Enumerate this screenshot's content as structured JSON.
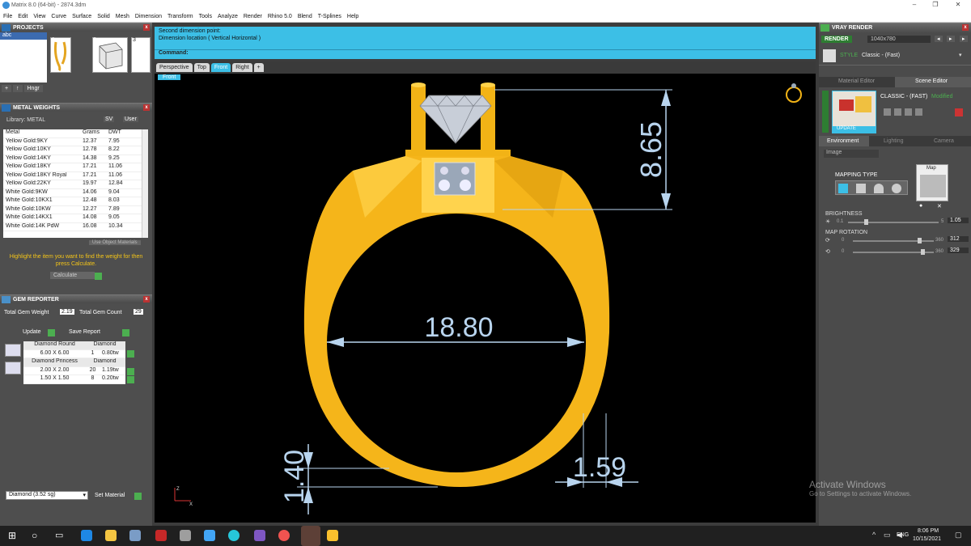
{
  "window": {
    "title": "Matrix 8.0 (64-bit) - 2874.3dm"
  },
  "menu": [
    "File",
    "Edit",
    "View",
    "Curve",
    "Surface",
    "Solid",
    "Mesh",
    "Dimension",
    "Transform",
    "Tools",
    "Analyze",
    "Render",
    "Rhino 5.0",
    "Blend",
    "T-Splines",
    "Help"
  ],
  "projects": {
    "header": "PROJECTS",
    "item": "abc",
    "thumb_labels": [
      "1",
      "2",
      "3"
    ],
    "buttons": [
      "+",
      "↑",
      "Hngr"
    ]
  },
  "metal_weights": {
    "header": "METAL WEIGHTS",
    "library_label": "Library: METAL",
    "sv_label": "SV",
    "user_label": "User",
    "columns": [
      "Metal",
      "Grams",
      "DWT"
    ],
    "rows": [
      [
        "Yellow Gold:9KY",
        "12.37",
        "7.95"
      ],
      [
        "Yellow Gold:10KY",
        "12.78",
        "8.22"
      ],
      [
        "Yellow Gold:14KY",
        "14.38",
        "9.25"
      ],
      [
        "Yellow Gold:18KY",
        "17.21",
        "11.06"
      ],
      [
        "Yellow Gold:18KY Royal",
        "17.21",
        "11.06"
      ],
      [
        "Yellow Gold:22KY",
        "19.97",
        "12.84"
      ],
      [
        "White Gold:9KW",
        "14.06",
        "9.04"
      ],
      [
        "White Gold:10KX1",
        "12.48",
        "8.03"
      ],
      [
        "White Gold:10KW",
        "12.27",
        "7.89"
      ],
      [
        "White Gold:14KX1",
        "14.08",
        "9.05"
      ],
      [
        "White Gold:14K PdW",
        "16.08",
        "10.34"
      ]
    ],
    "use_object_materials": "Use Object Materials",
    "hint": "Highlight the item you want to find the weight for then press Calculate.",
    "calculate": "Calculate"
  },
  "gem_reporter": {
    "header": "GEM REPORTER",
    "total_weight_label": "Total Gem Weight",
    "total_weight": "2.19",
    "total_count_label": "Total Gem Count",
    "total_count": "29",
    "update": "Update",
    "save_report": "Save Report",
    "groups": [
      {
        "shape": "Diamond Round",
        "material": "Diamond",
        "rows": [
          [
            "6.00 X 6.00",
            "1",
            "0.80tw"
          ]
        ]
      },
      {
        "shape": "Diamond Princess",
        "material": "Diamond",
        "rows": [
          [
            "2.00 X 2.00",
            "20",
            "1.19tw"
          ],
          [
            "1.50 X 1.50",
            "8",
            "0.20tw"
          ]
        ]
      }
    ]
  },
  "material_select": {
    "value": "Diamond     (3.52 sg)",
    "set_material": "Set Material"
  },
  "command": {
    "line1": "Second dimension point:",
    "line2": "Dimension location ( Vertical  Horizontal )",
    "prompt": "Command:"
  },
  "viewport_tabs": [
    "Perspective",
    "Top",
    "Front",
    "Right",
    "+"
  ],
  "active_tab": "Front",
  "viewport_label": "Front",
  "dimensions": {
    "height": "8.65",
    "inner": "18.80",
    "shank_width": "1.59",
    "shank_thickness": "1.40"
  },
  "axis": {
    "z": "Z",
    "x": "X"
  },
  "vray": {
    "header": "VRAY RENDER",
    "render": "RENDER",
    "resolution": "1040x780",
    "style_label": "STYLE",
    "style_value": "Classic - (Fast)",
    "tabs": [
      "Material Editor",
      "Scene Editor"
    ],
    "scene_title": "CLASSIC - (FAST)",
    "modified": "Modified",
    "update": "UPDATE",
    "env_tabs": [
      "Environment",
      "Lighting",
      "Camera"
    ],
    "env_type": "Image",
    "mapping_type": "MAPPING TYPE",
    "map_label": "Map",
    "brightness": {
      "label": "BRIGHTNESS",
      "min": "0.1",
      "max": "5",
      "value": "1.05"
    },
    "map_rotation": {
      "label": "MAP ROTATION",
      "r1": {
        "min": "0",
        "max": "360",
        "value": "312"
      },
      "r2": {
        "min": "0",
        "max": "360",
        "value": "329"
      }
    }
  },
  "watermark": {
    "line1": "Activate Windows",
    "line2": "Go to Settings to activate Windows."
  },
  "taskbar": {
    "lang": "ENG",
    "time": "8:06 PM",
    "date": "10/15/2021"
  },
  "colors": {
    "gold": "#f7b81a",
    "cyan": "#3cbfe6",
    "dim": "#b8d4ee"
  }
}
